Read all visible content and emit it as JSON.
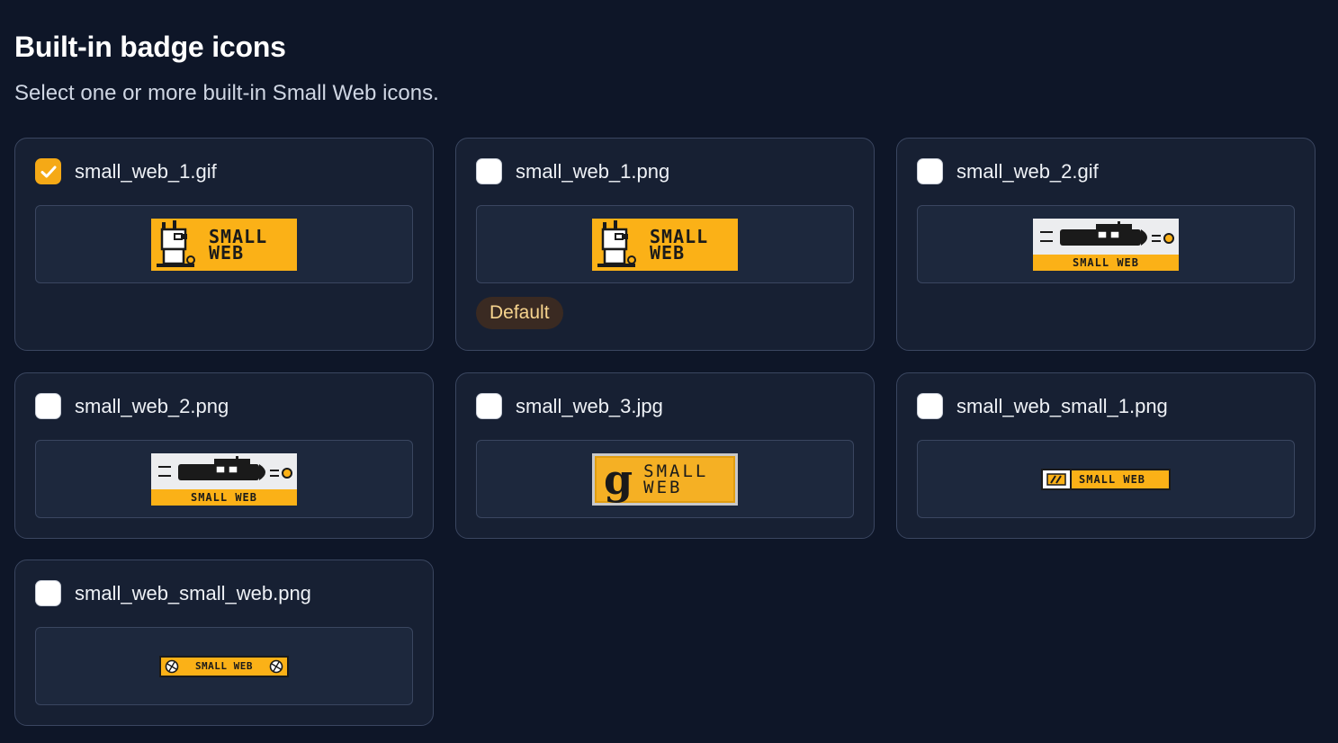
{
  "section": {
    "title": "Built-in badge icons",
    "subtitle": "Select one or more built-in Small Web icons."
  },
  "colors": {
    "background": "#0e1628",
    "card": "#172033",
    "border": "#3a4660",
    "accent": "#f5a916",
    "badge_yellow": "#fbb117",
    "default_tag_bg": "#3a2a22",
    "default_tag_text": "#f7d48e"
  },
  "icons": [
    {
      "file": "small_web_1.gif",
      "checked": true,
      "badge_text": [
        "SMALL",
        "WEB"
      ]
    },
    {
      "file": "small_web_1.png",
      "checked": false,
      "badge_text": [
        "SMALL",
        "WEB"
      ],
      "tag": "Default"
    },
    {
      "file": "small_web_2.gif",
      "checked": false,
      "badge_text": [
        "SMALL WEB"
      ]
    },
    {
      "file": "small_web_2.png",
      "checked": false,
      "badge_text": [
        "SMALL WEB"
      ]
    },
    {
      "file": "small_web_3.jpg",
      "checked": false,
      "badge_text": [
        "g",
        "SMALL",
        "WEB"
      ]
    },
    {
      "file": "small_web_small_1.png",
      "checked": false,
      "badge_text": [
        "SMALL WEB"
      ]
    },
    {
      "file": "small_web_small_web.png",
      "checked": false,
      "badge_text": [
        "SMALL WEB"
      ]
    }
  ]
}
